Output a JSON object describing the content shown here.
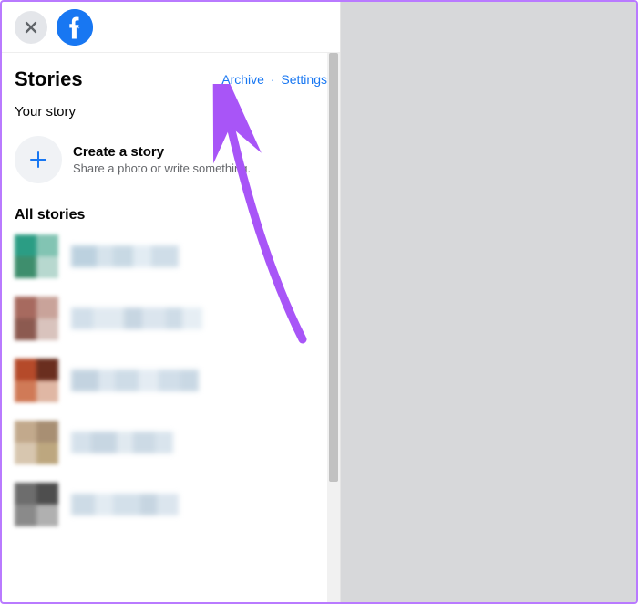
{
  "topbar": {
    "close_aria": "Close",
    "logo_name": "facebook-logo"
  },
  "header": {
    "title": "Stories",
    "archive_label": "Archive",
    "settings_label": "Settings"
  },
  "your_story": {
    "section_label": "Your story",
    "create_title": "Create a story",
    "create_subtitle": "Share a photo or write something."
  },
  "all_stories": {
    "section_label": "All stories",
    "items": [
      {
        "avatar_colors": [
          "#2b9d84",
          "#82c4b3",
          "#3e8e6d",
          "#b7d8cf"
        ],
        "name_blocks": [
          28,
          18,
          22,
          20,
          30
        ],
        "name_tints": [
          "#bcd1df",
          "#d6e3ec",
          "#c8d9e4",
          "#e2ecf3",
          "#cfdde8"
        ]
      },
      {
        "avatar_colors": [
          "#a76a5f",
          "#c9a39a",
          "#8c5a50",
          "#d9c3bd"
        ],
        "name_blocks": [
          24,
          34,
          20,
          26,
          18,
          22
        ],
        "name_tints": [
          "#d2dfea",
          "#e1eaf1",
          "#c7d6e2",
          "#dbe5ee",
          "#cedce7",
          "#e6eef4"
        ]
      },
      {
        "avatar_colors": [
          "#b54a2a",
          "#6a2e1f",
          "#d07a57",
          "#e0b7a4"
        ],
        "name_blocks": [
          30,
          18,
          26,
          22,
          24,
          20
        ],
        "name_tints": [
          "#c3d3e0",
          "#dce6ef",
          "#cedce7",
          "#e4ecf3",
          "#d1dee9",
          "#c9d8e4"
        ]
      },
      {
        "avatar_colors": [
          "#c2a98c",
          "#a88f73",
          "#d7c6af",
          "#bda77f"
        ],
        "name_blocks": [
          22,
          28,
          18,
          24,
          20
        ],
        "name_tints": [
          "#d5e1eb",
          "#c7d6e2",
          "#e0e9f0",
          "#ccdae5",
          "#d9e4ed"
        ]
      },
      {
        "avatar_colors": [
          "#6d6d6d",
          "#4e4e4e",
          "#8a8a8a",
          "#b0b0b0"
        ],
        "name_blocks": [
          26,
          20,
          30,
          18,
          24
        ],
        "name_tints": [
          "#cddbe6",
          "#e2ebf2",
          "#d3e0ea",
          "#c6d5e1",
          "#dbe5ee"
        ]
      }
    ]
  },
  "annotation": {
    "arrow_color": "#a855f7"
  }
}
